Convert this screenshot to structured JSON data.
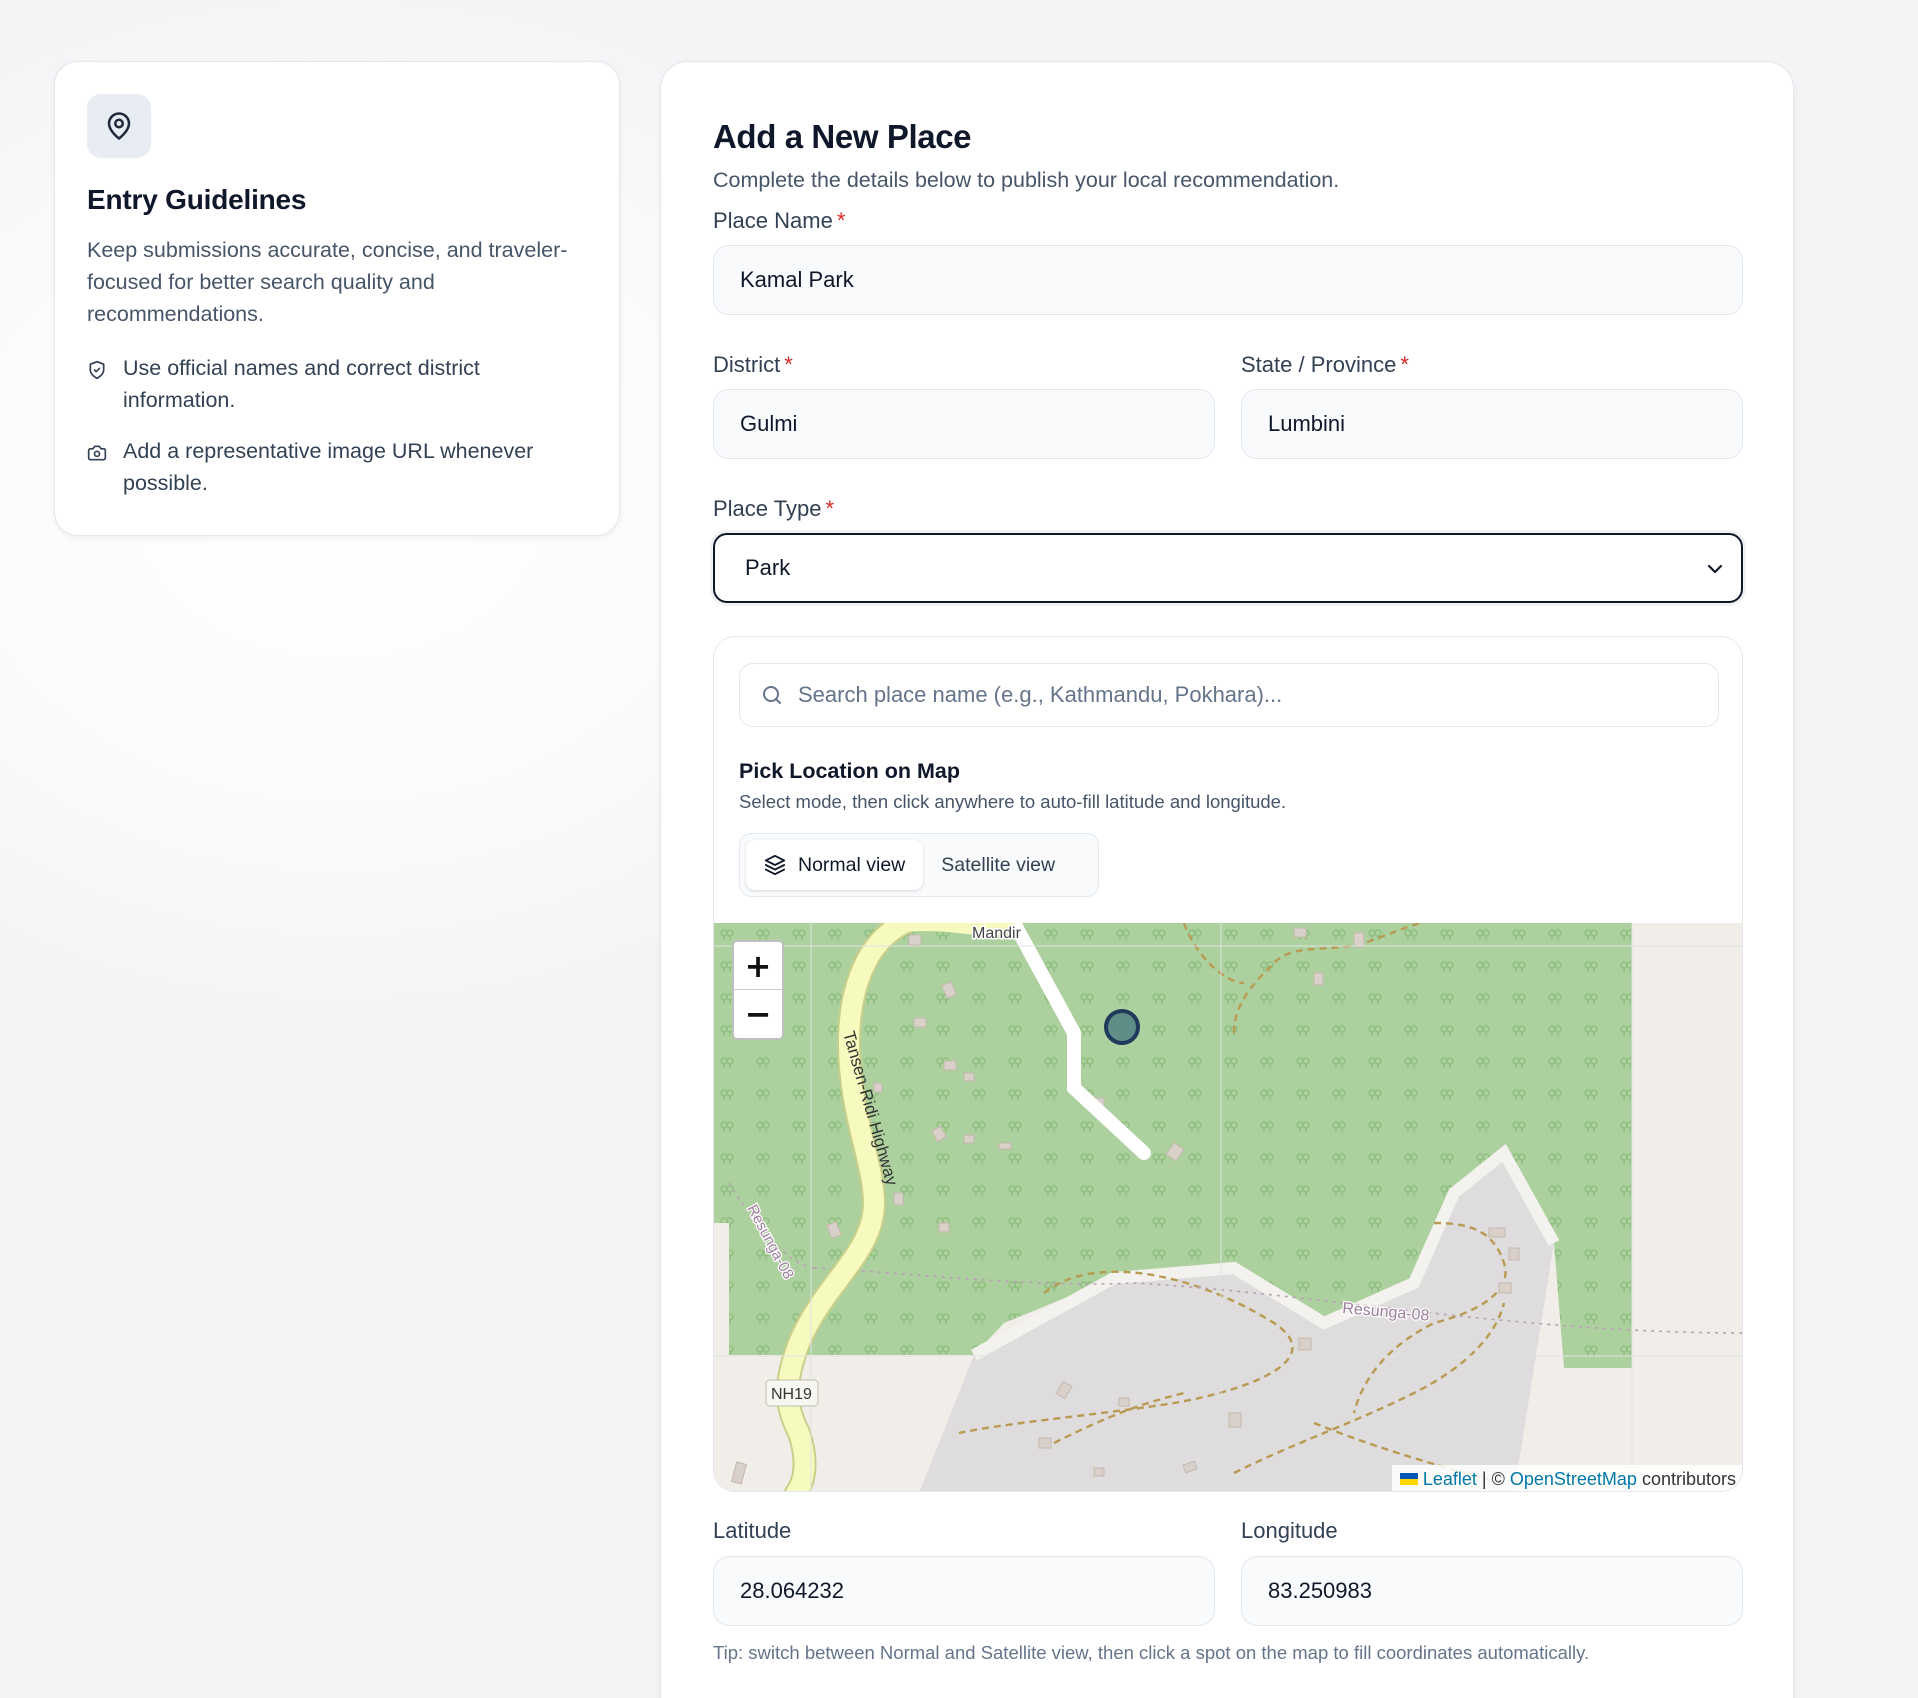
{
  "guidelines": {
    "title": "Entry Guidelines",
    "description": "Keep submissions accurate, concise, and traveler-focused for better search quality and recommendations.",
    "items": [
      {
        "icon": "shield-check-icon",
        "text": "Use official names and correct district information."
      },
      {
        "icon": "camera-icon",
        "text": "Add a representative image URL whenever possible."
      }
    ]
  },
  "form": {
    "title": "Add a New Place",
    "subtitle": "Complete the details below to publish your local recommendation.",
    "place_name": {
      "label": "Place Name",
      "value": "Kamal Park"
    },
    "district": {
      "label": "District",
      "value": "Gulmi"
    },
    "state": {
      "label": "State / Province",
      "value": "Lumbini"
    },
    "place_type": {
      "label": "Place Type",
      "value": "Park"
    },
    "required_mark": "*",
    "map_picker": {
      "search_placeholder": "Search place name (e.g., Kathmandu, Pokhara)...",
      "title": "Pick Location on Map",
      "subtitle": "Select mode, then click anywhere to auto-fill latitude and longitude.",
      "modes": [
        "Normal view",
        "Satellite view"
      ],
      "active_mode": "Normal view",
      "zoom_in": "+",
      "zoom_out": "−",
      "labels": {
        "mandir": "Mandir",
        "highway": "Tansen-Ridi Highway",
        "resunga_left": "Resunga-08",
        "resunga_right": "Resunga-08",
        "nh": "NH19"
      },
      "attribution": {
        "leaflet": "Leaflet",
        "sep": "| ©",
        "osm": "OpenStreetMap",
        "contributors": "contributors"
      }
    },
    "latitude": {
      "label": "Latitude",
      "value": "28.064232"
    },
    "longitude": {
      "label": "Longitude",
      "value": "83.250983"
    },
    "tip": "Tip: switch between Normal and Satellite view, then click a spot on the map to fill coordinates automatically."
  },
  "colors": {
    "accent": "#0f172a",
    "required": "#dc2626",
    "forest": "#add19e",
    "highway": "#f7fabf"
  }
}
